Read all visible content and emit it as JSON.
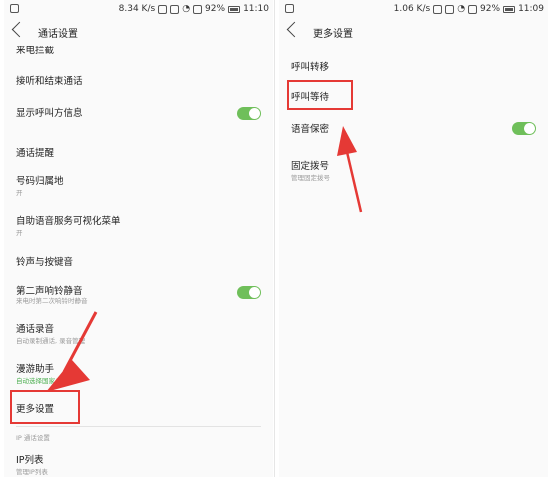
{
  "left": {
    "status": {
      "speed": "8.34 K/s",
      "battery": "92%",
      "time": "11:10"
    },
    "title": "通话设置",
    "cut_top": "来电拦截",
    "items": [
      {
        "label": "接听和结束通话"
      },
      {
        "label": "显示呼叫方信息",
        "toggle": true
      },
      {
        "label": "通话提醒"
      },
      {
        "label": "号码归属地",
        "sub": "开"
      },
      {
        "label": "自助语音服务可视化菜单",
        "sub": "开"
      },
      {
        "label": "铃声与按键音"
      },
      {
        "label": "第二声响铃静音",
        "sub": "来电时第二次响铃时静音",
        "toggle": true
      },
      {
        "label": "通话录音",
        "sub": "自动录制通话, 录音管理"
      },
      {
        "label": "漫游助手",
        "sub": "自动选择国家/地区",
        "sub_green": true
      },
      {
        "label": "更多设置"
      }
    ],
    "section_label": "IP 通话设置",
    "ip": {
      "label": "IP列表",
      "sub": "管理IP列表"
    }
  },
  "right": {
    "status": {
      "speed": "1.06 K/s",
      "battery": "92%",
      "time": "11:09"
    },
    "title": "更多设置",
    "items": [
      {
        "label": "呼叫转移"
      },
      {
        "label": "呼叫等待"
      },
      {
        "label": "语音保密",
        "toggle": true
      },
      {
        "label": "固定拨号",
        "sub": "管理固定拨号"
      }
    ]
  },
  "colors": {
    "toggle_on": "#6fbf5a",
    "annotation_red": "#e53935"
  }
}
